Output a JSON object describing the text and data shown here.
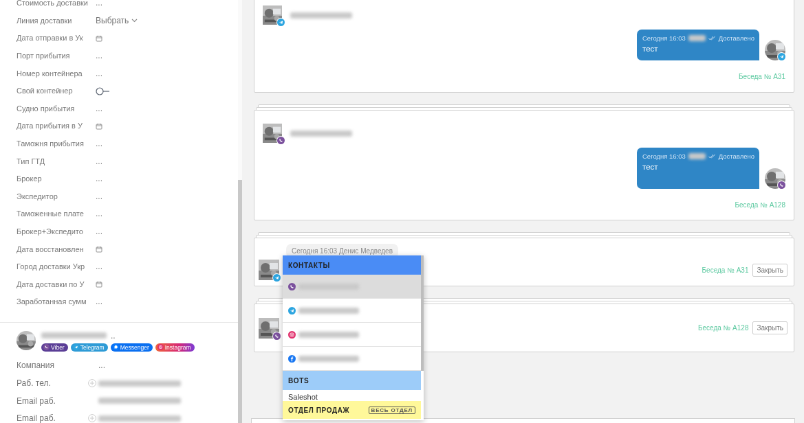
{
  "fields": [
    {
      "label": "Стоимость доставки",
      "kind": "text",
      "value": "..."
    },
    {
      "label": "Линия доставки",
      "kind": "select",
      "value": "Выбрать"
    },
    {
      "label": "Дата отправки в Ук",
      "kind": "date"
    },
    {
      "label": "Порт прибытия",
      "kind": "text",
      "value": "..."
    },
    {
      "label": "Номер контейнера",
      "kind": "text",
      "value": "..."
    },
    {
      "label": "Свой контейнер",
      "kind": "toggle",
      "on": false
    },
    {
      "label": "Судно прибытия",
      "kind": "text",
      "value": "..."
    },
    {
      "label": "Дата прибытия в У",
      "kind": "date"
    },
    {
      "label": "Таможня прибытия",
      "kind": "text",
      "value": "..."
    },
    {
      "label": "Тип ГТД",
      "kind": "text",
      "value": "..."
    },
    {
      "label": "Брокер",
      "kind": "text",
      "value": "..."
    },
    {
      "label": "Экспедитор",
      "kind": "text",
      "value": "..."
    },
    {
      "label": "Таможенные плате",
      "kind": "text",
      "value": "..."
    },
    {
      "label": "Брокер+Экспедито",
      "kind": "text",
      "value": "..."
    },
    {
      "label": "Дата восстановлен",
      "kind": "date"
    },
    {
      "label": "Город доставки Укр",
      "kind": "text",
      "value": "..."
    },
    {
      "label": "Дата доставки по У",
      "kind": "date"
    },
    {
      "label": "Заработанная сумм",
      "kind": "text",
      "value": "..."
    }
  ],
  "contact": {
    "more": "..",
    "tags": [
      {
        "label": "Viber",
        "kind": "viber"
      },
      {
        "label": "Telegram",
        "kind": "telegram"
      },
      {
        "label": "Messenger",
        "kind": "messenger"
      },
      {
        "label": "Instagram",
        "kind": "instagram"
      }
    ],
    "fields": [
      {
        "label": "Компания",
        "kind": "text",
        "value": "...",
        "add": false
      },
      {
        "label": "Раб. тел.",
        "kind": "hidden",
        "add": true
      },
      {
        "label": "Email раб.",
        "kind": "hidden",
        "add": false
      },
      {
        "label": "Email раб.",
        "kind": "hidden",
        "add": true
      }
    ]
  },
  "conversations": [
    {
      "kind": "expanded",
      "stacked": false,
      "avatar": {
        "kind": "telegram"
      },
      "message": {
        "time": "Сегодня 16:03",
        "status": "Доставлено",
        "text": "тест"
      },
      "footer": "Беседа № A31"
    },
    {
      "kind": "expanded",
      "stacked": true,
      "avatar": {
        "kind": "viber"
      },
      "message": {
        "time": "Сегодня 16:03",
        "status": "Доставлено",
        "text": "тест"
      },
      "footer": "Беседа № A128"
    },
    {
      "kind": "collapsed",
      "stacked": true,
      "avatar": {
        "kind": "telegram"
      },
      "incoming": "Сегодня 16:03 Денис Медведев",
      "footer": "Беседа № A31",
      "close": "Закрыть"
    },
    {
      "kind": "collapsed",
      "stacked": true,
      "avatar": {
        "kind": "viber"
      },
      "footer": "Беседа № A128",
      "close": "Закрыть"
    }
  ],
  "menu": {
    "sections": [
      {
        "title": "КОНТАКТЫ",
        "kind": "contacts",
        "items": [
          {
            "kind": "viber",
            "selected": true
          },
          {
            "kind": "telegram",
            "selected": false
          },
          {
            "kind": "instagram",
            "selected": false
          },
          {
            "kind": "facebook",
            "selected": false
          }
        ]
      },
      {
        "title": "BOTS",
        "kind": "bots",
        "items": [
          {
            "label": "Saleshot",
            "selected": false
          }
        ]
      },
      {
        "title": "ОТДЕЛ ПРОДАЖ",
        "kind": "department",
        "action": "ВЕСЬ ОТДЕЛ"
      }
    ]
  }
}
